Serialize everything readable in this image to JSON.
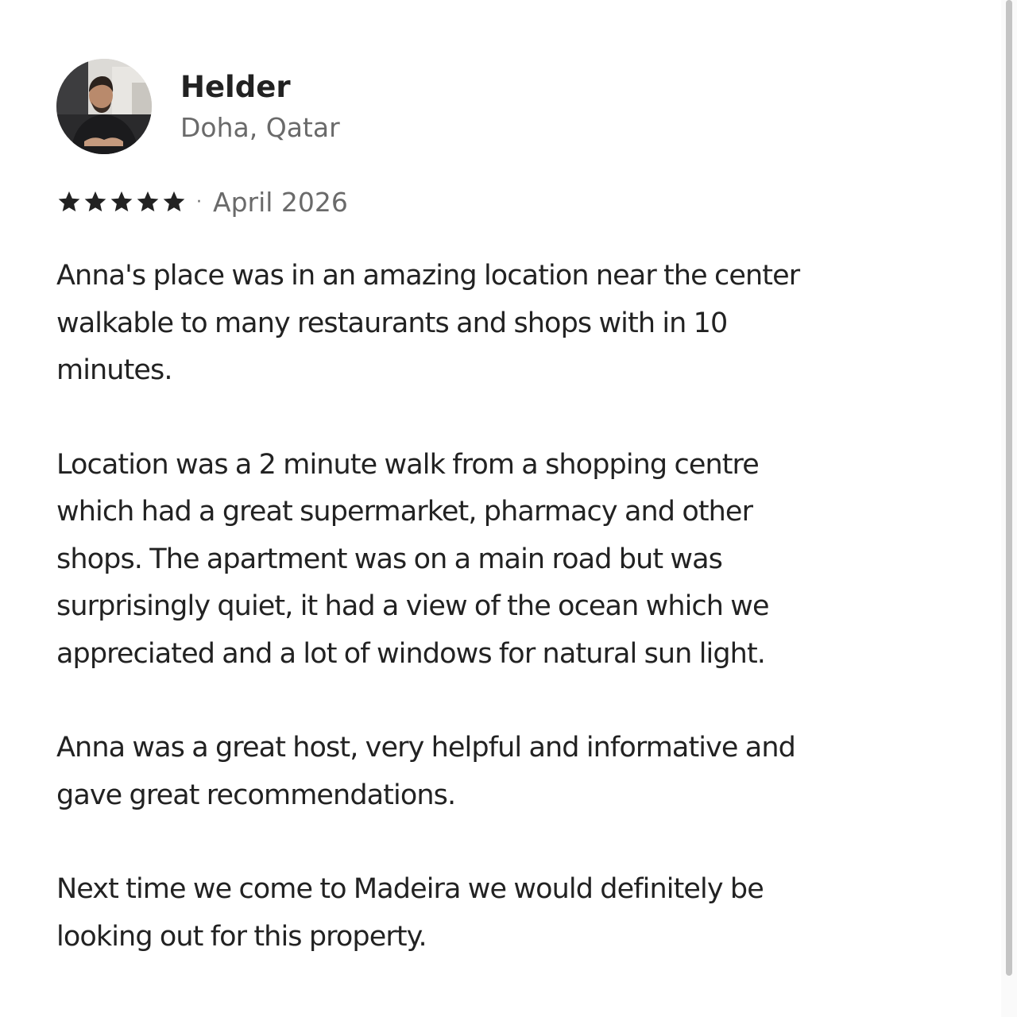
{
  "reviewer": {
    "name": "Helder",
    "location": "Doha, Qatar"
  },
  "rating": {
    "stars": 5,
    "max_stars": 5,
    "star_color": "#222222",
    "separator": "·",
    "date": "April 2026"
  },
  "review": {
    "paragraphs": [
      "Anna's place was in an amazing location near the center\nwalkable to many restaurants and shops with in  10\nminutes.",
      "Location was a 2 minute walk from a shopping centre\nwhich had a great supermarket, pharmacy and other\nshops. The apartment was on a main road but was\nsurprisingly quiet, it had a view of the ocean which we\nappreciated and a lot of windows for natural sun light.",
      "Anna was a great host, very helpful and informative and\ngave great recommendations.",
      "Next time we come to Madeira we would definitely be\nlooking out for this property."
    ]
  },
  "icons": {
    "star": "star-icon",
    "avatar": "user-avatar"
  },
  "colors": {
    "text_primary": "#222222",
    "text_secondary": "#6a6a6a",
    "background": "#ffffff"
  }
}
